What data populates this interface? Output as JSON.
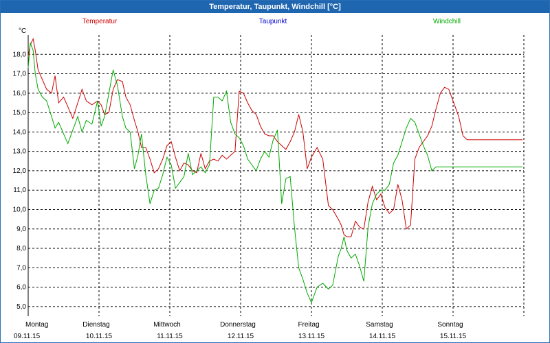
{
  "window": {
    "title": "Temperatur, Taupunkt, Windchill [°C]"
  },
  "colors": {
    "temperatur": "#cc0000",
    "taupunkt": "#0000cc",
    "windchill": "#00aa00",
    "grid": "#000000"
  },
  "chart_data": {
    "type": "line",
    "title": "Temperatur, Taupunkt, Windchill [°C]",
    "ylabel": "°C",
    "ylim": [
      4.5,
      19.0
    ],
    "xlim": [
      0,
      7.0
    ],
    "grid": true,
    "yticks": [
      5.0,
      6.0,
      7.0,
      8.0,
      9.0,
      10.0,
      11.0,
      12.0,
      13.0,
      14.0,
      15.0,
      16.0,
      17.0,
      18.0
    ],
    "ytick_labels": [
      "5,0",
      "6,0",
      "7,0",
      "8,0",
      "9,0",
      "10,0",
      "11,0",
      "12,0",
      "13,0",
      "14,0",
      "15,0",
      "16,0",
      "17,0",
      "18,0"
    ],
    "xticks": [
      0,
      1,
      2,
      3,
      4,
      5,
      6
    ],
    "day_labels": [
      {
        "day": "Montag",
        "date": "09.11.15"
      },
      {
        "day": "Dienstag",
        "date": "10.11.15"
      },
      {
        "day": "Mittwoch",
        "date": "11.11.15"
      },
      {
        "day": "Donnerstag",
        "date": "12.11.15"
      },
      {
        "day": "Freitag",
        "date": "13.11.15"
      },
      {
        "day": "Samstag",
        "date": "14.11.15"
      },
      {
        "day": "Sonntag",
        "date": "15.11.15"
      }
    ],
    "series": [
      {
        "name": "Temperatur",
        "color": "#cc0000",
        "x": [
          0,
          0.03,
          0.07,
          0.1,
          0.14,
          0.2,
          0.26,
          0.33,
          0.38,
          0.43,
          0.5,
          0.56,
          0.63,
          0.7,
          0.76,
          0.82,
          0.9,
          0.98,
          1.03,
          1.08,
          1.14,
          1.2,
          1.26,
          1.33,
          1.38,
          1.44,
          1.5,
          1.55,
          1.6,
          1.66,
          1.72,
          1.78,
          1.84,
          1.9,
          1.96,
          2.02,
          2.08,
          2.14,
          2.2,
          2.26,
          2.32,
          2.38,
          2.44,
          2.5,
          2.56,
          2.62,
          2.68,
          2.74,
          2.8,
          2.86,
          2.92,
          2.98,
          3.04,
          3.1,
          3.16,
          3.22,
          3.28,
          3.34,
          3.4,
          3.46,
          3.52,
          3.58,
          3.64,
          3.7,
          3.76,
          3.82,
          3.88,
          3.94,
          4.0,
          4.08,
          4.16,
          4.24,
          4.3,
          4.38,
          4.42,
          4.46,
          4.5,
          4.56,
          4.62,
          4.68,
          4.74,
          4.8,
          4.86,
          4.92,
          4.98,
          5.04,
          5.1,
          5.16,
          5.22,
          5.28,
          5.34,
          5.4,
          5.46,
          5.52,
          5.58,
          5.64,
          5.7,
          5.76,
          5.82,
          5.88,
          5.94,
          5.98,
          6.02,
          6.08,
          6.14,
          6.2,
          6.26,
          6.32,
          6.38,
          6.44,
          6.5,
          6.56,
          6.62,
          6.68,
          6.74,
          6.8,
          6.86,
          6.92,
          6.98
        ],
        "y": [
          17.9,
          18.5,
          18.8,
          18.2,
          17.2,
          16.7,
          16.2,
          16.0,
          16.9,
          15.5,
          15.8,
          15.3,
          14.7,
          15.5,
          16.2,
          15.6,
          15.4,
          15.6,
          15.4,
          14.9,
          15.0,
          16.2,
          16.7,
          16.6,
          15.8,
          15.4,
          14.6,
          14.0,
          13.2,
          13.2,
          12.6,
          11.9,
          12.1,
          12.6,
          13.3,
          13.5,
          12.7,
          12.0,
          12.4,
          12.3,
          12.0,
          11.9,
          12.9,
          12.1,
          12.5,
          12.6,
          12.5,
          12.8,
          12.6,
          12.8,
          13.0,
          16.1,
          16.0,
          15.5,
          15.1,
          14.9,
          14.3,
          13.9,
          13.8,
          13.8,
          13.5,
          13.3,
          13.1,
          13.5,
          14.0,
          14.9,
          14.0,
          12.1,
          12.7,
          13.2,
          12.6,
          10.2,
          10.0,
          9.5,
          9.2,
          8.7,
          8.6,
          8.6,
          9.4,
          9.1,
          9.0,
          10.4,
          11.2,
          10.5,
          10.8,
          10.1,
          9.8,
          10.0,
          11.3,
          10.5,
          9.0,
          9.2,
          12.6,
          13.2,
          13.5,
          13.8,
          14.3,
          15.2,
          16.0,
          16.3,
          16.2,
          15.8,
          15.4,
          14.8,
          13.8,
          13.6,
          13.6,
          13.6,
          13.6,
          13.6,
          13.6,
          13.6,
          13.6,
          13.6,
          13.6,
          13.6,
          13.6,
          13.6,
          13.6
        ]
      },
      {
        "name": "Taupunkt",
        "color": "#0000cc",
        "x": [],
        "y": []
      },
      {
        "name": "Windchill",
        "color": "#00aa00",
        "x": [
          0,
          0.03,
          0.07,
          0.1,
          0.14,
          0.2,
          0.26,
          0.33,
          0.38,
          0.43,
          0.5,
          0.56,
          0.63,
          0.7,
          0.76,
          0.82,
          0.9,
          0.98,
          1.03,
          1.08,
          1.14,
          1.2,
          1.26,
          1.33,
          1.38,
          1.44,
          1.5,
          1.55,
          1.6,
          1.66,
          1.72,
          1.78,
          1.84,
          1.9,
          1.96,
          2.02,
          2.08,
          2.14,
          2.2,
          2.26,
          2.32,
          2.38,
          2.44,
          2.5,
          2.56,
          2.62,
          2.68,
          2.74,
          2.8,
          2.86,
          2.92,
          2.98,
          3.04,
          3.1,
          3.16,
          3.22,
          3.28,
          3.34,
          3.4,
          3.46,
          3.52,
          3.58,
          3.64,
          3.7,
          3.76,
          3.82,
          3.88,
          3.94,
          4.0,
          4.08,
          4.16,
          4.24,
          4.3,
          4.38,
          4.42,
          4.46,
          4.5,
          4.56,
          4.62,
          4.68,
          4.74,
          4.8,
          4.86,
          4.92,
          4.98,
          5.04,
          5.1,
          5.16,
          5.22,
          5.28,
          5.34,
          5.4,
          5.46,
          5.52,
          5.58,
          5.64,
          5.7,
          5.76,
          5.82,
          5.88,
          5.94,
          5.98,
          6.02,
          6.08,
          6.14,
          6.2,
          6.26,
          6.32,
          6.38,
          6.44,
          6.5,
          6.56,
          6.62,
          6.68,
          6.74,
          6.8,
          6.86,
          6.92,
          6.98
        ],
        "y": [
          17.3,
          18.6,
          18.2,
          17.0,
          16.2,
          15.8,
          15.6,
          14.8,
          14.2,
          14.5,
          13.9,
          13.4,
          14.1,
          14.8,
          14.0,
          14.6,
          14.4,
          15.6,
          14.3,
          14.8,
          16.0,
          17.2,
          16.4,
          14.8,
          14.2,
          14.0,
          12.1,
          12.8,
          13.9,
          11.8,
          10.3,
          11.0,
          11.1,
          11.8,
          12.7,
          12.3,
          11.1,
          11.4,
          11.7,
          12.9,
          11.8,
          12.0,
          12.2,
          11.9,
          12.3,
          15.8,
          15.8,
          15.6,
          16.1,
          14.5,
          13.9,
          13.7,
          13.3,
          12.6,
          12.3,
          12.0,
          12.6,
          13.0,
          12.7,
          13.6,
          14.1,
          10.3,
          11.6,
          11.7,
          9.1,
          7.0,
          6.4,
          5.7,
          5.2,
          6.0,
          6.2,
          5.9,
          6.1,
          7.6,
          8.0,
          8.6,
          7.9,
          7.5,
          7.7,
          7.1,
          6.3,
          9.1,
          10.3,
          10.8,
          11.0,
          11.0,
          11.3,
          12.4,
          12.8,
          13.5,
          14.2,
          14.7,
          14.5,
          13.9,
          13.3,
          12.8,
          12.0,
          12.2,
          12.2,
          12.2,
          12.2,
          12.2,
          12.2,
          12.2,
          12.2,
          12.2,
          12.2,
          12.2,
          12.2,
          12.2,
          12.2,
          12.2,
          12.2,
          12.2,
          12.2,
          12.2,
          12.2,
          12.2,
          12.2
        ]
      }
    ],
    "legend_placement": "top"
  }
}
